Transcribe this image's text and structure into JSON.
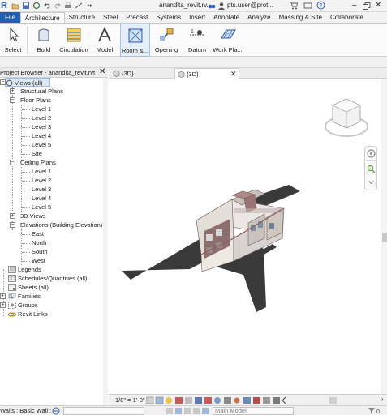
{
  "titlebar": {
    "doc_title": "anandita_revit.rv...",
    "user": "pts.user@prot..."
  },
  "tabs": [
    "File",
    "Architecture",
    "Structure",
    "Steel",
    "Precast",
    "Systems",
    "Insert",
    "Annotate",
    "Analyze",
    "Massing & Site",
    "Collaborate"
  ],
  "ribbon": {
    "buttons": [
      "Select",
      "Build",
      "Circulation",
      "Model",
      "Room &...",
      "Opening",
      "Datum",
      "Work Pla..."
    ]
  },
  "project_browser": {
    "title": "Project Browser - anandita_revit.rvt",
    "root": "Views (all)",
    "structural_plans": "Structural Plans",
    "floor_plans": "Floor Plans",
    "floor_levels": [
      "Level 1",
      "Level 2",
      "Level 3",
      "Level 4",
      "Level 5",
      "Site"
    ],
    "ceiling_plans": "Ceiling Plans",
    "ceiling_levels": [
      "Level 1",
      "Level 2",
      "Level 3",
      "Level 4",
      "Level 5"
    ],
    "views_3d": "3D Views",
    "elevations": "Elevations (Building Elevation)",
    "elevation_items": [
      "East",
      "North",
      "South",
      "West"
    ],
    "legends": "Legends",
    "schedules": "Schedules/Quantities (all)",
    "sheets": "Sheets (all)",
    "families": "Families",
    "groups": "Groups",
    "revit_links": "Revit Links"
  },
  "view_tabs": [
    "{3D}",
    "{3D}"
  ],
  "view_control": {
    "scale": "1/8\" = 1'-0\""
  },
  "status": {
    "text": "Walls : Basic Wall :",
    "model": "Main Model"
  },
  "colors": {
    "file_tab": "#1f5fb4",
    "accent": "#2a5db0"
  }
}
